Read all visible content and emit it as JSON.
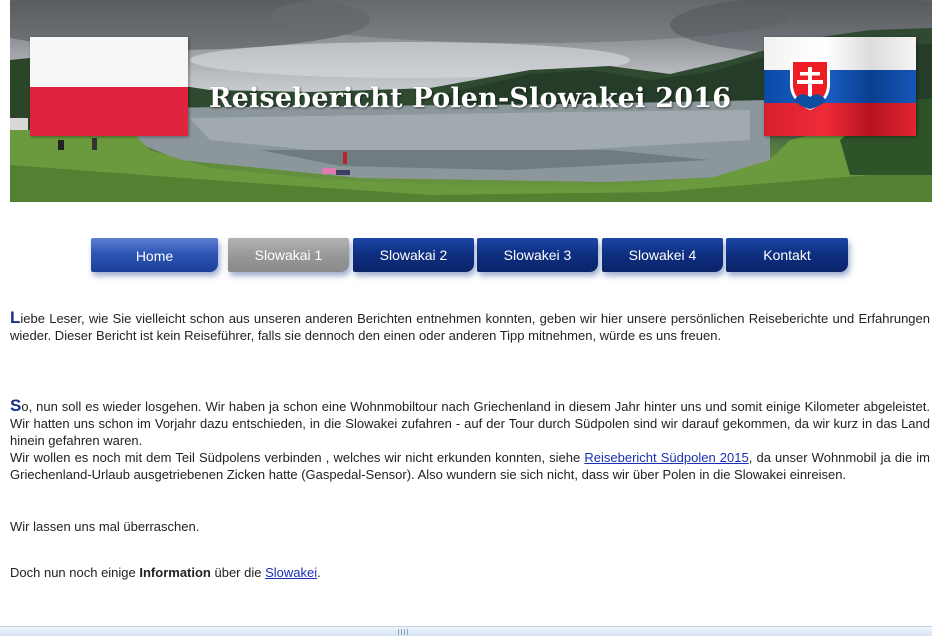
{
  "banner": {
    "title": "Reisebericht Polen-Slowakei 2016"
  },
  "nav": {
    "items": [
      {
        "label": "Home"
      },
      {
        "label": "Slowakai 1"
      },
      {
        "label": "Slowakai 2"
      },
      {
        "label": "Slowakei 3"
      },
      {
        "label": "Slowakei 4"
      },
      {
        "label": "Kontakt"
      }
    ],
    "active_index": 1
  },
  "content": {
    "p1": {
      "initial": "L",
      "text": "iebe Leser, wie Sie vielleicht schon aus unseren anderen Berichten entnehmen konnten, geben wir hier unsere persönlichen Reiseberichte und Erfahrungen wieder. Dieser Bericht ist kein Reiseführer, falls sie dennoch den einen oder anderen Tipp mitnehmen, würde es uns freuen."
    },
    "p2": {
      "initial": "S",
      "text_a": "o, nun soll es wieder losgehen. Wir haben ja schon eine Wohnmobiltour nach Griechenland in diesem Jahr hinter uns und somit einige Kilometer abgeleistet. Wir hatten uns schon im  Vorjahr dazu entschieden, in die Slowakei zufahren - auf der Tour durch Südpolen sind wir darauf gekommen, da wir kurz  in das Land hinein gefahren waren.",
      "text_b": "Wir wollen es noch mit dem Teil Südpolens verbinden , welches wir nicht erkunden konnten, siehe ",
      "link": "Reisebericht Südpolen 2015",
      "text_c": ", da unser Wohnmobil ja die im Griechenland-Urlaub ausgetriebenen Zicken hatte (Gaspedal-Sensor). Also wundern sie sich nicht, dass wir über Polen in die Slowakei einreisen."
    },
    "p3": "Wir lassen uns mal überraschen.",
    "p4": {
      "text_a": "Doch nun noch einige ",
      "bold": "Information",
      "text_b": " über die ",
      "link": "Slowakei",
      "text_c": "."
    }
  },
  "colors": {
    "nav_blue": "#0f2f82",
    "nav_active": "#979797",
    "drop_cap": "#1b2e88",
    "link": "#1a2fb5",
    "flag_red": "#e0233e"
  },
  "icons": [
    "polish-flag-icon",
    "slovak-flag-icon",
    "slovak-coat-of-arms-icon"
  ]
}
